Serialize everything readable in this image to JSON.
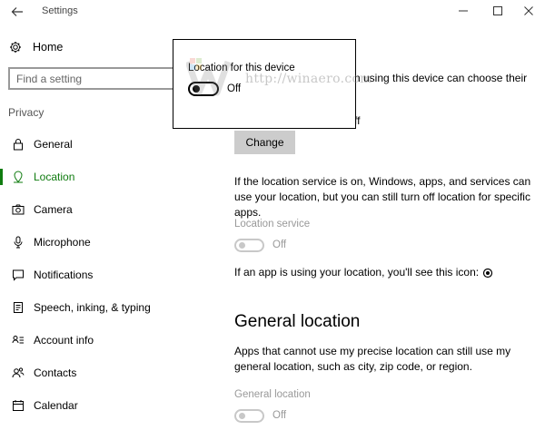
{
  "window": {
    "title": "Settings"
  },
  "sidebar": {
    "home_label": "Home",
    "search_placeholder": "Find a setting",
    "section": "Privacy",
    "items": [
      {
        "label": "General",
        "icon": "lock-icon"
      },
      {
        "label": "Location",
        "icon": "location-icon",
        "active": true
      },
      {
        "label": "Camera",
        "icon": "camera-icon"
      },
      {
        "label": "Microphone",
        "icon": "microphone-icon"
      },
      {
        "label": "Notifications",
        "icon": "notifications-icon"
      },
      {
        "label": "Speech, inking, & typing",
        "icon": "speech-icon"
      },
      {
        "label": "Account info",
        "icon": "account-icon"
      },
      {
        "label": "Contacts",
        "icon": "contacts-icon"
      },
      {
        "label": "Calendar",
        "icon": "calendar-icon"
      }
    ]
  },
  "main": {
    "intro_visible": "n using this device can choose their",
    "status_fragment": "ff",
    "change_label": "Change",
    "service_paragraph": "If the location service is on, Windows, apps, and services can use your location, but you can still turn off location for specific apps.",
    "location_service_label": "Location service",
    "location_service_state": "Off",
    "icon_sentence": "If an app is using your location, you'll see this icon:",
    "general_heading": "General location",
    "general_paragraph": "Apps that cannot use my precise location can still use my general location, such as city, zip code, or region.",
    "general_location_label": "General location",
    "general_location_state": "Off"
  },
  "popup": {
    "title": "Location for this device",
    "state": "Off"
  },
  "watermark": {
    "text": "http://winaero.com"
  },
  "colors": {
    "accent": "#107c10",
    "disabled": "#999999",
    "button": "#cccccc"
  }
}
